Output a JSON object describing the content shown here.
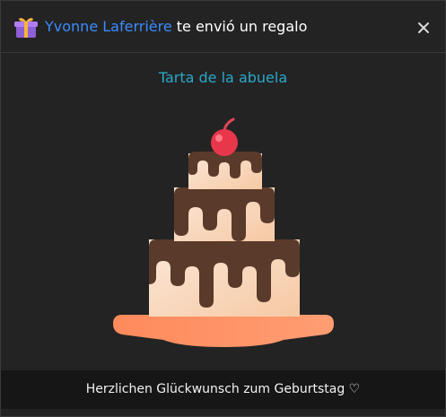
{
  "header": {
    "sender_name": "Yvonne Laferrière",
    "title_suffix": " te envió un regalo",
    "gift_icon": "gift-icon",
    "close_icon": "close-icon"
  },
  "gift": {
    "name": "Tarta de la abuela",
    "image": "birthday-cake-illustration"
  },
  "message": {
    "text": "Herzlichen Glückwunsch zum Geburtstag ♡"
  },
  "colors": {
    "sender": "#3a8cff",
    "gift_name": "#2aa8c9",
    "background": "#232323"
  }
}
